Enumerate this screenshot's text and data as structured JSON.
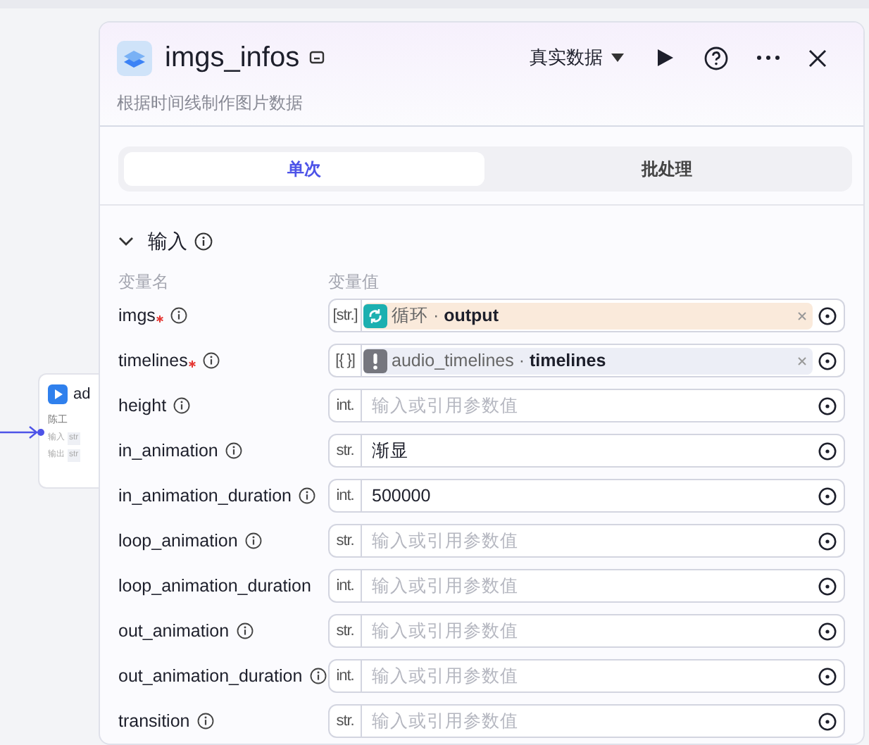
{
  "canvas_node": {
    "title": "ad",
    "author": "陈工",
    "rows": [
      {
        "label": "输入",
        "tag": "str"
      },
      {
        "label": "输出",
        "tag": "str"
      }
    ]
  },
  "panel": {
    "title": "imgs_infos",
    "subtitle": "根据时间线制作图片数据",
    "data_mode": "真实数据"
  },
  "tabs": [
    {
      "label": "单次",
      "selected": true
    },
    {
      "label": "批处理",
      "selected": false
    }
  ],
  "section": {
    "title": "输入",
    "expanded": true,
    "col_name": "变量名",
    "col_value": "变量值"
  },
  "params": [
    {
      "name": "imgs",
      "required": true,
      "info": true,
      "type": "[str.]",
      "kind": "ref",
      "ref_valid": true,
      "reference": "循环 · **output**",
      "color": "#faeadb"
    },
    {
      "name": "timelines",
      "required": true,
      "info": true,
      "type": "[{ }]",
      "kind": "ref",
      "ref_valid": false,
      "reference": "audio_timelines · **timelines**",
      "color": "#eceef6"
    },
    {
      "name": "height",
      "required": false,
      "info": true,
      "type": "int.",
      "kind": "input",
      "placeholder": "输入或引用参数值"
    },
    {
      "name": "in_animation",
      "required": false,
      "info": true,
      "type": "str.",
      "kind": "input",
      "value": "渐显"
    },
    {
      "name": "in_animation_duration",
      "required": false,
      "info": true,
      "type": "int.",
      "kind": "input",
      "value": "500000"
    },
    {
      "name": "loop_animation",
      "required": false,
      "info": true,
      "type": "str.",
      "kind": "input",
      "placeholder": "输入或引用参数值"
    },
    {
      "name": "loop_animation_duration",
      "required": false,
      "info": false,
      "type": "int.",
      "kind": "input",
      "placeholder": "输入或引用参数值"
    },
    {
      "name": "out_animation",
      "required": false,
      "info": true,
      "type": "str.",
      "kind": "input",
      "placeholder": "输入或引用参数值"
    },
    {
      "name": "out_animation_duration",
      "required": false,
      "info": true,
      "type": "int.",
      "kind": "input",
      "placeholder": "输入或引用参数值"
    },
    {
      "name": "transition",
      "required": false,
      "info": true,
      "type": "str.",
      "kind": "input",
      "placeholder": "输入或引用参数值"
    }
  ]
}
